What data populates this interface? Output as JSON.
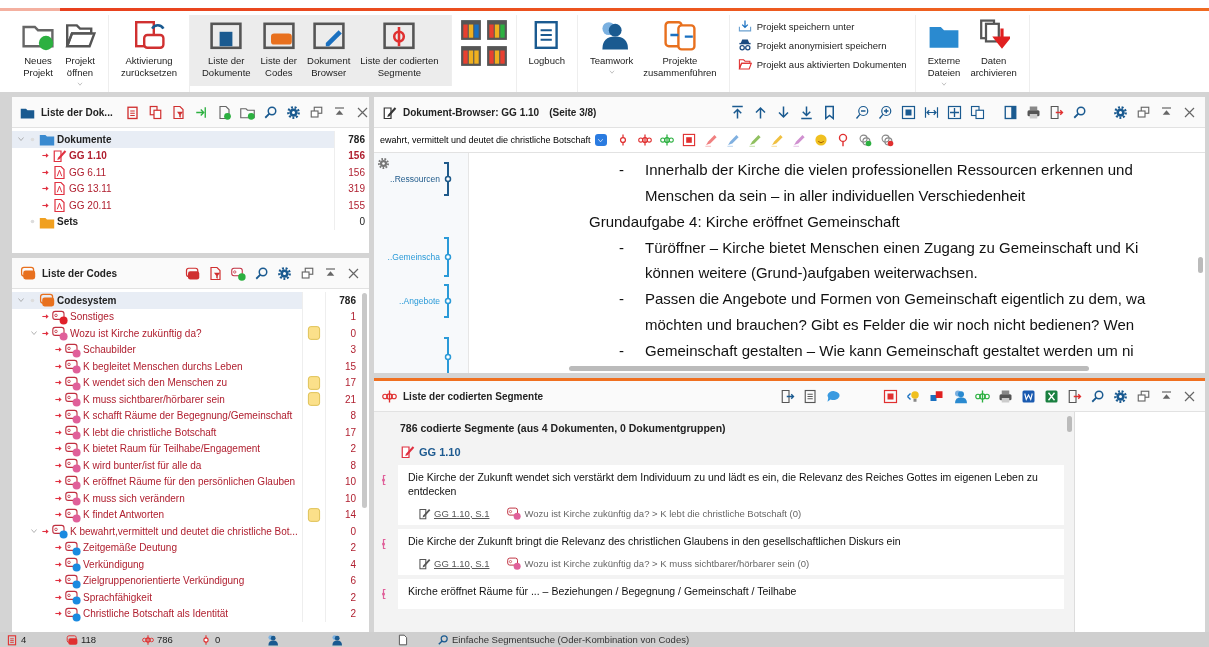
{
  "ribbon": {
    "groups": [
      {
        "highlighted": false,
        "kind": "large",
        "items": [
          {
            "label": [
              "Neues",
              "Projekt"
            ],
            "menu": false
          },
          {
            "label": [
              "Projekt",
              "öffnen"
            ],
            "menu": true
          }
        ]
      },
      {
        "highlighted": false,
        "kind": "large",
        "items": [
          {
            "label": [
              "Aktivierung",
              "zurücksetzen"
            ],
            "menu": false
          }
        ]
      },
      {
        "highlighted": true,
        "kind": "large",
        "items": [
          {
            "label": [
              "Liste der",
              "Dokumente"
            ],
            "menu": false
          },
          {
            "label": [
              "Liste der",
              "Codes"
            ],
            "menu": false
          },
          {
            "label": [
              "Dokument",
              "Browser"
            ],
            "menu": false
          },
          {
            "label": [
              "Liste der codierten",
              "Segmente"
            ],
            "menu": false
          }
        ]
      },
      {
        "highlighted": false,
        "kind": "layouts"
      },
      {
        "highlighted": false,
        "kind": "large",
        "items": [
          {
            "label": [
              "Logbuch"
            ],
            "menu": false
          }
        ]
      },
      {
        "highlighted": false,
        "kind": "large",
        "items": [
          {
            "label": [
              "Teamwork"
            ],
            "menu": true
          },
          {
            "label": [
              "Projekte",
              "zusammenführen"
            ],
            "menu": false
          }
        ]
      },
      {
        "highlighted": false,
        "kind": "stack",
        "items": [
          {
            "label": [
              "Projekt speichern unter"
            ]
          },
          {
            "label": [
              "Projekt anonymisiert speichern"
            ]
          },
          {
            "label": [
              "Projekt aus aktivierten Dokumenten"
            ]
          }
        ]
      },
      {
        "highlighted": false,
        "kind": "large",
        "items": [
          {
            "label": [
              "Externe",
              "Dateien"
            ],
            "menu": true
          },
          {
            "label": [
              "Daten",
              "archivieren"
            ],
            "menu": false
          }
        ]
      }
    ]
  },
  "documents": {
    "title": "Liste der Dok...",
    "tree": [
      {
        "kind": "folder",
        "label": "Dokumente",
        "count": "786",
        "expanded": true,
        "selected": true,
        "activated": false,
        "children": [
          {
            "kind": "pdf",
            "label": "GG 1.10",
            "count": "156",
            "open": true,
            "selected": false,
            "activated": true
          },
          {
            "kind": "pdf",
            "label": "GG 6.11",
            "count": "156",
            "open": false,
            "selected": false,
            "activated": true
          },
          {
            "kind": "pdf",
            "label": "GG 13.11",
            "count": "319",
            "open": false,
            "selected": false,
            "activated": true
          },
          {
            "kind": "pdf",
            "label": "GG 20.11",
            "count": "155",
            "open": false,
            "selected": false,
            "activated": true
          }
        ]
      },
      {
        "kind": "set",
        "label": "Sets",
        "count": "0",
        "selected": false,
        "activated": false
      }
    ]
  },
  "codes": {
    "title": "Liste der Codes",
    "tree": [
      {
        "kind": "root",
        "label": "Codesystem",
        "count": "786",
        "expanded": true,
        "selected": true,
        "activated": false,
        "memo": false,
        "children": [
          {
            "label": "Sonstiges",
            "count": "1",
            "color": "#e0202a",
            "memo": false,
            "selected": false,
            "activated": true
          },
          {
            "label": "Wozu ist Kirche zukünftig da?",
            "count": "0",
            "color": "#e0609a",
            "memo": true,
            "selected": false,
            "activated": true,
            "expanded": true,
            "children": [
              {
                "label": "Schaubilder",
                "count": "3",
                "color": "#e0609a",
                "memo": false,
                "selected": false,
                "activated": true
              },
              {
                "label": "K begleitet Menschen durchs Leben",
                "count": "15",
                "color": "#e0609a",
                "memo": false,
                "selected": false,
                "activated": true
              },
              {
                "label": "K wendet sich den Menschen zu",
                "count": "17",
                "color": "#e0609a",
                "memo": true,
                "selected": false,
                "activated": true
              },
              {
                "label": "K muss sichtbarer/hörbarer sein",
                "count": "21",
                "color": "#e0609a",
                "memo": true,
                "selected": false,
                "activated": true
              },
              {
                "label": "K schafft Räume der Begegnung/Gemeinschaft",
                "count": "8",
                "color": "#e0609a",
                "memo": false,
                "selected": false,
                "activated": true
              },
              {
                "label": "K lebt die christliche Botschaft",
                "count": "17",
                "color": "#e0609a",
                "memo": false,
                "selected": false,
                "activated": true
              },
              {
                "label": "K bietet Raum für Teilhabe/Engagement",
                "count": "2",
                "color": "#e0609a",
                "memo": false,
                "selected": false,
                "activated": true
              },
              {
                "label": "K wird bunter/ist für alle da",
                "count": "8",
                "color": "#e0609a",
                "memo": false,
                "selected": false,
                "activated": true
              },
              {
                "label": "K eröffnet Räume für den persönlichen Glauben",
                "count": "10",
                "color": "#e0609a",
                "memo": false,
                "selected": false,
                "activated": true
              },
              {
                "label": "K muss sich verändern",
                "count": "10",
                "color": "#e0609a",
                "memo": false,
                "selected": false,
                "activated": true
              },
              {
                "label": "K findet Antworten",
                "count": "14",
                "color": "#e0609a",
                "memo": true,
                "selected": false,
                "activated": true
              }
            ]
          },
          {
            "label": "K bewahrt,vermittelt und deutet die christliche Bot...",
            "count": "0",
            "color": "#1a8ae0",
            "memo": false,
            "selected": false,
            "activated": true,
            "expanded": true,
            "children": [
              {
                "label": "Zeitgemäße Deutung",
                "count": "2",
                "color": "#1a8ae0",
                "memo": false,
                "selected": false,
                "activated": true
              },
              {
                "label": "Verkündigung",
                "count": "4",
                "color": "#1a8ae0",
                "memo": false,
                "selected": false,
                "activated": true
              },
              {
                "label": "Zielgruppenorientierte Verkündigung",
                "count": "6",
                "color": "#1a8ae0",
                "memo": false,
                "selected": false,
                "activated": true
              },
              {
                "label": "Sprachfähigkeit",
                "count": "2",
                "color": "#1a8ae0",
                "memo": false,
                "selected": false,
                "activated": true
              },
              {
                "label": "Christliche Botschaft als Identität",
                "count": "2",
                "color": "#1a8ae0",
                "memo": false,
                "selected": false,
                "activated": true
              }
            ]
          }
        ]
      }
    ]
  },
  "browser": {
    "title": "Dokument-Browser: GG 1.10",
    "page": "(Seite 3/8)",
    "code_field": "ewahrt, vermittelt und deutet die christliche Botschaft",
    "margin_codes": [
      {
        "label": "..Ressourcen",
        "color": "#1f5a8a"
      },
      {
        "label": "..Gemeinscha",
        "color": "#2a9ad8"
      },
      {
        "label": "..Angebote",
        "color": "#2a9ad8"
      },
      {
        "color": "#2a9ad8"
      }
    ],
    "lines": [
      {
        "kind": "dash",
        "marker": "-",
        "text": "Innerhalb der Kirche die vielen professionellen Ressourcen erkennen und"
      },
      {
        "kind": "cont",
        "text": "Menschen da sein – in aller individuellen Verschiedenheit"
      },
      {
        "kind": "heading",
        "text": "Grundaufgabe 4: Kirche eröffnet Gemeinschaft"
      },
      {
        "kind": "dash",
        "marker": "-",
        "text": "Türöffner – Kirche bietet Menschen einen Zugang zu Gemeinschaft und Ki"
      },
      {
        "kind": "cont",
        "text": "können weitere (Grund-)aufgaben weiterwachsen."
      },
      {
        "kind": "dash",
        "marker": "-",
        "text": "Passen die Angebote und Formen von Gemeinschaft eigentlich zu dem, wa"
      },
      {
        "kind": "cont",
        "text": "möchten und brauchen? Gibt es Felder die wir noch nicht bedienen? Wen"
      },
      {
        "kind": "dash",
        "marker": "-",
        "text": "Gemeinschaft gestalten – Wie kann Gemeinschaft gestaltet werden um ni"
      }
    ]
  },
  "segments": {
    "title": "Liste der codierten Segmente",
    "summary": "786 codierte Segmente (aus 4 Dokumenten, 0 Dokumentgruppen)",
    "document": "GG 1.10",
    "items": [
      {
        "text": "Die Kirche der Zukunft wendet sich verstärkt dem Individuum zu und lädt es ein, die Relevanz  des Reiches Gottes im eigenen Leben zu entdecken",
        "source": "GG 1.10, S.1",
        "code": "Wozu ist Kirche zukünftig da? > K lebt die christliche Botschaft (0)",
        "color": "#e0609a"
      },
      {
        "text": "Die Kirche der Zukunft bringt die Relevanz des christlichen Glaubens in den gesellschaftlichen  Diskurs ein",
        "source": "GG 1.10, S.1",
        "code": "Wozu ist Kirche zukünftig da? > K muss sichtbarer/hörbarer sein (0)",
        "color": "#e0609a"
      },
      {
        "text": "Kirche eröffnet Räume für ... – Beziehungen / Begegnung / Gemeinschaft / Teilhabe",
        "color": "#e0609a"
      }
    ]
  },
  "status_bar": {
    "documents": "4",
    "codes": "118",
    "segments": "786",
    "memos": "0",
    "search": "Einfache Segmentsuche (Oder-Kombination von Codes)"
  }
}
